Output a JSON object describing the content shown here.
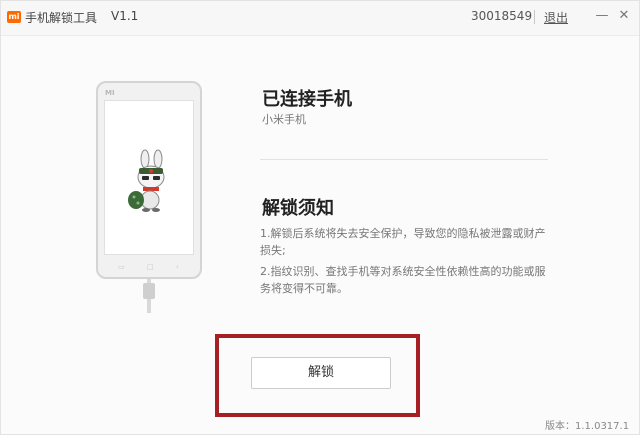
{
  "titlebar": {
    "logo_text": "mi",
    "title": "手机解锁工具",
    "version": "V1.1",
    "account_id": "30018549",
    "logout_label": "退出",
    "minimize_glyph": "—",
    "close_glyph": "✕"
  },
  "phone": {
    "brand_text": "MI",
    "mascot_icon": "mitu-bunny-mascot-icon"
  },
  "content": {
    "connected_title": "已连接手机",
    "model_name": "小米手机",
    "notice_title": "解锁须知",
    "notices": [
      "1.解锁后系统将失去安全保护，导致您的隐私被泄露或财产损失;",
      "2.指纹识别、查找手机等对系统安全性依赖性高的功能或服务将变得不可靠。"
    ]
  },
  "actions": {
    "unlock_label": "解锁"
  },
  "footer": {
    "version_text": "版本：1.1.0317.1"
  },
  "colors": {
    "highlight_border": "#a51f24",
    "mi_orange": "#ff6a00"
  }
}
